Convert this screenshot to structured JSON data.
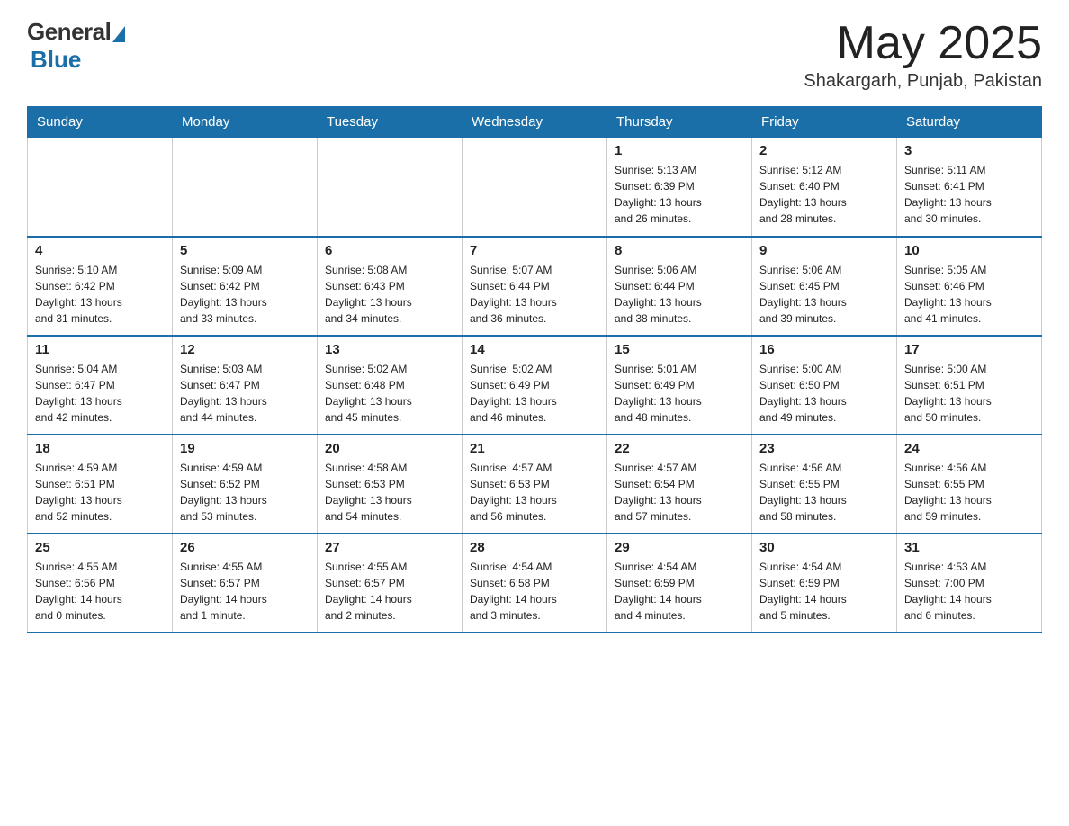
{
  "logo": {
    "general": "General",
    "blue": "Blue",
    "subtitle": "Blue"
  },
  "header": {
    "month": "May 2025",
    "location": "Shakargarh, Punjab, Pakistan"
  },
  "days_of_week": [
    "Sunday",
    "Monday",
    "Tuesday",
    "Wednesday",
    "Thursday",
    "Friday",
    "Saturday"
  ],
  "weeks": [
    [
      {
        "day": "",
        "info": ""
      },
      {
        "day": "",
        "info": ""
      },
      {
        "day": "",
        "info": ""
      },
      {
        "day": "",
        "info": ""
      },
      {
        "day": "1",
        "info": "Sunrise: 5:13 AM\nSunset: 6:39 PM\nDaylight: 13 hours\nand 26 minutes."
      },
      {
        "day": "2",
        "info": "Sunrise: 5:12 AM\nSunset: 6:40 PM\nDaylight: 13 hours\nand 28 minutes."
      },
      {
        "day": "3",
        "info": "Sunrise: 5:11 AM\nSunset: 6:41 PM\nDaylight: 13 hours\nand 30 minutes."
      }
    ],
    [
      {
        "day": "4",
        "info": "Sunrise: 5:10 AM\nSunset: 6:42 PM\nDaylight: 13 hours\nand 31 minutes."
      },
      {
        "day": "5",
        "info": "Sunrise: 5:09 AM\nSunset: 6:42 PM\nDaylight: 13 hours\nand 33 minutes."
      },
      {
        "day": "6",
        "info": "Sunrise: 5:08 AM\nSunset: 6:43 PM\nDaylight: 13 hours\nand 34 minutes."
      },
      {
        "day": "7",
        "info": "Sunrise: 5:07 AM\nSunset: 6:44 PM\nDaylight: 13 hours\nand 36 minutes."
      },
      {
        "day": "8",
        "info": "Sunrise: 5:06 AM\nSunset: 6:44 PM\nDaylight: 13 hours\nand 38 minutes."
      },
      {
        "day": "9",
        "info": "Sunrise: 5:06 AM\nSunset: 6:45 PM\nDaylight: 13 hours\nand 39 minutes."
      },
      {
        "day": "10",
        "info": "Sunrise: 5:05 AM\nSunset: 6:46 PM\nDaylight: 13 hours\nand 41 minutes."
      }
    ],
    [
      {
        "day": "11",
        "info": "Sunrise: 5:04 AM\nSunset: 6:47 PM\nDaylight: 13 hours\nand 42 minutes."
      },
      {
        "day": "12",
        "info": "Sunrise: 5:03 AM\nSunset: 6:47 PM\nDaylight: 13 hours\nand 44 minutes."
      },
      {
        "day": "13",
        "info": "Sunrise: 5:02 AM\nSunset: 6:48 PM\nDaylight: 13 hours\nand 45 minutes."
      },
      {
        "day": "14",
        "info": "Sunrise: 5:02 AM\nSunset: 6:49 PM\nDaylight: 13 hours\nand 46 minutes."
      },
      {
        "day": "15",
        "info": "Sunrise: 5:01 AM\nSunset: 6:49 PM\nDaylight: 13 hours\nand 48 minutes."
      },
      {
        "day": "16",
        "info": "Sunrise: 5:00 AM\nSunset: 6:50 PM\nDaylight: 13 hours\nand 49 minutes."
      },
      {
        "day": "17",
        "info": "Sunrise: 5:00 AM\nSunset: 6:51 PM\nDaylight: 13 hours\nand 50 minutes."
      }
    ],
    [
      {
        "day": "18",
        "info": "Sunrise: 4:59 AM\nSunset: 6:51 PM\nDaylight: 13 hours\nand 52 minutes."
      },
      {
        "day": "19",
        "info": "Sunrise: 4:59 AM\nSunset: 6:52 PM\nDaylight: 13 hours\nand 53 minutes."
      },
      {
        "day": "20",
        "info": "Sunrise: 4:58 AM\nSunset: 6:53 PM\nDaylight: 13 hours\nand 54 minutes."
      },
      {
        "day": "21",
        "info": "Sunrise: 4:57 AM\nSunset: 6:53 PM\nDaylight: 13 hours\nand 56 minutes."
      },
      {
        "day": "22",
        "info": "Sunrise: 4:57 AM\nSunset: 6:54 PM\nDaylight: 13 hours\nand 57 minutes."
      },
      {
        "day": "23",
        "info": "Sunrise: 4:56 AM\nSunset: 6:55 PM\nDaylight: 13 hours\nand 58 minutes."
      },
      {
        "day": "24",
        "info": "Sunrise: 4:56 AM\nSunset: 6:55 PM\nDaylight: 13 hours\nand 59 minutes."
      }
    ],
    [
      {
        "day": "25",
        "info": "Sunrise: 4:55 AM\nSunset: 6:56 PM\nDaylight: 14 hours\nand 0 minutes."
      },
      {
        "day": "26",
        "info": "Sunrise: 4:55 AM\nSunset: 6:57 PM\nDaylight: 14 hours\nand 1 minute."
      },
      {
        "day": "27",
        "info": "Sunrise: 4:55 AM\nSunset: 6:57 PM\nDaylight: 14 hours\nand 2 minutes."
      },
      {
        "day": "28",
        "info": "Sunrise: 4:54 AM\nSunset: 6:58 PM\nDaylight: 14 hours\nand 3 minutes."
      },
      {
        "day": "29",
        "info": "Sunrise: 4:54 AM\nSunset: 6:59 PM\nDaylight: 14 hours\nand 4 minutes."
      },
      {
        "day": "30",
        "info": "Sunrise: 4:54 AM\nSunset: 6:59 PM\nDaylight: 14 hours\nand 5 minutes."
      },
      {
        "day": "31",
        "info": "Sunrise: 4:53 AM\nSunset: 7:00 PM\nDaylight: 14 hours\nand 6 minutes."
      }
    ]
  ]
}
